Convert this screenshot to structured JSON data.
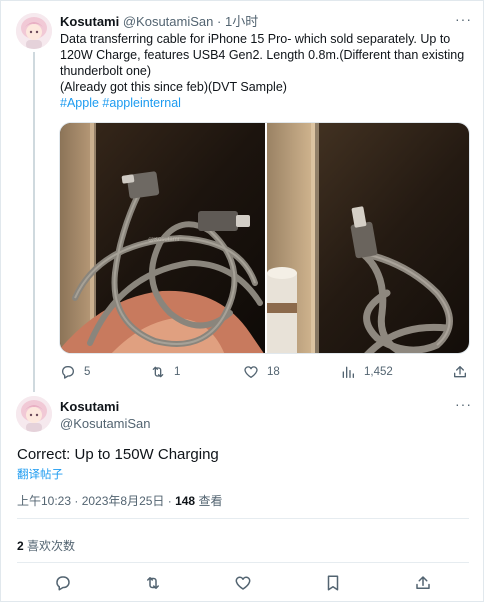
{
  "tweet": {
    "author_name": "Kosutami",
    "author_handle": "@KosutamiSan",
    "sep": "·",
    "time_ago": "1小时",
    "more": "···",
    "text_lines": [
      "Data transferring cable for iPhone 15 Pro- which sold separately. Up to",
      "120W Charge, features USB4 Gen2. Length 0.8m.(Different than existing",
      "thunderbolt one)",
      "(Already got this since feb)(DVT Sample)"
    ],
    "hashtags": [
      "#Apple",
      "#appleinternal"
    ],
    "replies": "5",
    "retweets": "1",
    "likes": "18",
    "views": "1,452"
  },
  "reply": {
    "author_name": "Kosutami",
    "author_handle": "@KosutamiSan",
    "more": "···",
    "text": "Correct: Up to 150W Charging",
    "translate": "翻译帖子",
    "timestamp": "上午10:23 · 2023年8月25日 · ",
    "view_count": "148",
    "view_label": " 查看",
    "like_count": "2",
    "like_label": " 喜欢次数"
  },
  "colors": {
    "accent": "#1d9bf0",
    "muted": "#536471",
    "text": "#0f1419"
  },
  "icons": [
    "reply-icon",
    "retweet-icon",
    "like-icon",
    "views-icon",
    "share-icon",
    "bookmark-icon",
    "more-icon"
  ]
}
